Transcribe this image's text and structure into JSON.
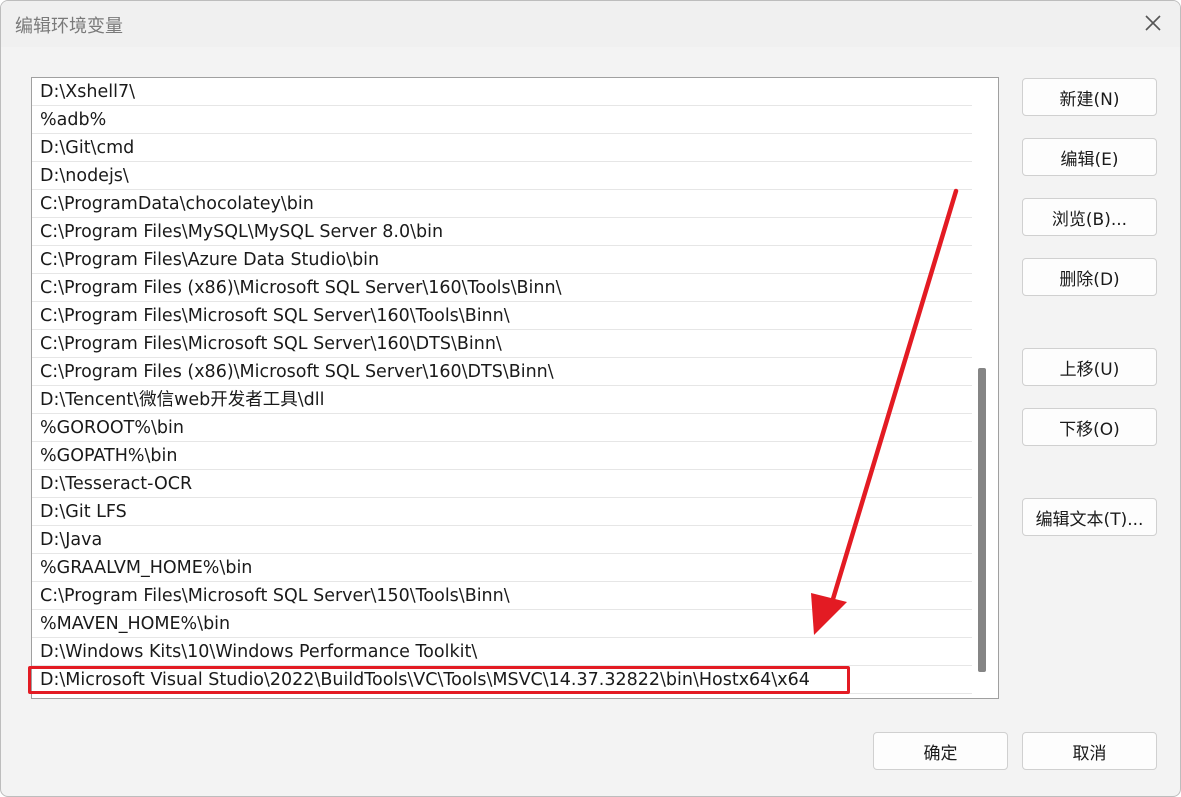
{
  "window": {
    "title": "编辑环境变量"
  },
  "paths": [
    "D:\\Xshell7\\",
    "%adb%",
    "D:\\Git\\cmd",
    "D:\\nodejs\\",
    "C:\\ProgramData\\chocolatey\\bin",
    "C:\\Program Files\\MySQL\\MySQL Server 8.0\\bin",
    "C:\\Program Files\\Azure Data Studio\\bin",
    "C:\\Program Files (x86)\\Microsoft SQL Server\\160\\Tools\\Binn\\",
    "C:\\Program Files\\Microsoft SQL Server\\160\\Tools\\Binn\\",
    "C:\\Program Files\\Microsoft SQL Server\\160\\DTS\\Binn\\",
    "C:\\Program Files (x86)\\Microsoft SQL Server\\160\\DTS\\Binn\\",
    "D:\\Tencent\\微信web开发者工具\\dll",
    "%GOROOT%\\bin",
    "%GOPATH%\\bin",
    "D:\\Tesseract-OCR",
    "D:\\Git LFS",
    "D:\\Java",
    "%GRAALVM_HOME%\\bin",
    "C:\\Program Files\\Microsoft SQL Server\\150\\Tools\\Binn\\",
    "%MAVEN_HOME%\\bin",
    "D:\\Windows Kits\\10\\Windows Performance Toolkit\\",
    "D:\\Microsoft Visual Studio\\2022\\BuildTools\\VC\\Tools\\MSVC\\14.37.32822\\bin\\Hostx64\\x64"
  ],
  "buttons": {
    "new": "新建(N)",
    "edit": "编辑(E)",
    "browse": "浏览(B)...",
    "delete": "删除(D)",
    "move_up": "上移(U)",
    "move_down": "下移(O)",
    "edit_text": "编辑文本(T)...",
    "ok": "确定",
    "cancel": "取消"
  },
  "icons": {
    "close": "close-icon"
  },
  "colors": {
    "annotation": "#e31b23"
  }
}
